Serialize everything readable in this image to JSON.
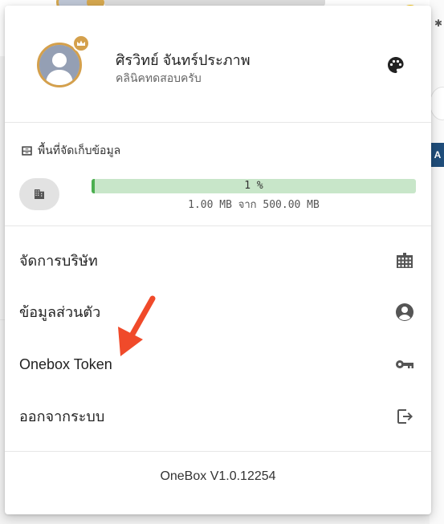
{
  "profile": {
    "name": "ศิรวิทย์ จันทร์ประภาพ",
    "organization": "คลินิคทดสอบครับ"
  },
  "storage": {
    "title": "พื้นที่จัดเก็บข้อมูล",
    "percent_label": "1 %",
    "percent_value": 0.01,
    "usage_text": "1.00 MB จาก 500.00 MB"
  },
  "menu_items": [
    {
      "label": "จัดการบริษัท",
      "icon": "building-icon"
    },
    {
      "label": "ข้อมูลส่วนตัว",
      "icon": "account-circle-icon"
    },
    {
      "label": "Onebox Token",
      "icon": "key-icon"
    },
    {
      "label": "ออกจากระบบ",
      "icon": "logout-icon"
    }
  ],
  "version": "OneBox V1.0.12254",
  "background": {
    "right_badge": "A"
  },
  "colors": {
    "progress_fill": "#4caf50",
    "progress_track": "#c8e6c9",
    "avatar_ring": "#d4a04c",
    "annotation_arrow": "#f04a2a"
  }
}
